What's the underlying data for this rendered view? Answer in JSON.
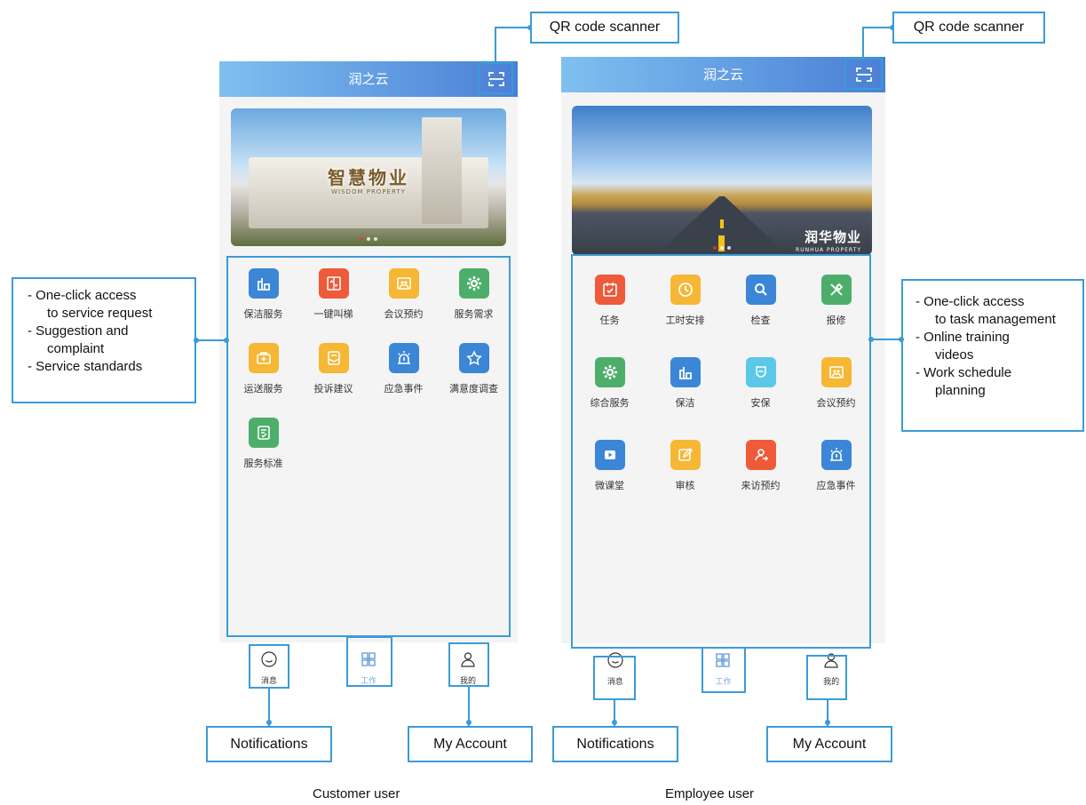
{
  "customer": {
    "app_title": "润之云",
    "banner": {
      "title": "智慧物业",
      "subtitle": "WISDOM PROPERTY"
    },
    "tiles": [
      {
        "label": "保洁服务",
        "icon": "building-icon",
        "color": "#3b86d6"
      },
      {
        "label": "一键叫梯",
        "icon": "elevator-icon",
        "color": "#ee5a3a"
      },
      {
        "label": "会议预约",
        "icon": "meeting-icon",
        "color": "#f6b735"
      },
      {
        "label": "服务需求",
        "icon": "gear-icon",
        "color": "#4dae6b"
      },
      {
        "label": "运送服务",
        "icon": "medkit-icon",
        "color": "#f6b735"
      },
      {
        "label": "投诉建议",
        "icon": "mail-icon",
        "color": "#f6b735"
      },
      {
        "label": "应急事件",
        "icon": "alarm-icon",
        "color": "#3b86d6"
      },
      {
        "label": "满意度调查",
        "icon": "star-icon",
        "color": "#3b86d6"
      },
      {
        "label": "服务标准",
        "icon": "checklist-icon",
        "color": "#4dae6b"
      }
    ],
    "tabbar": [
      {
        "label": "消息",
        "icon": "chat-icon",
        "active": false
      },
      {
        "label": "工作",
        "icon": "work-grid-icon",
        "active": true
      },
      {
        "label": "我的",
        "icon": "user-icon",
        "active": false
      }
    ],
    "caption": "Customer user"
  },
  "employee": {
    "app_title": "润之云",
    "banner": {
      "brand": "润华物业",
      "brand_sub": "RUNHUA PROPERTY"
    },
    "tiles": [
      {
        "label": "任务",
        "icon": "calendar-check-icon",
        "color": "#ee5a3a"
      },
      {
        "label": "工时安排",
        "icon": "clock-icon",
        "color": "#f6b735"
      },
      {
        "label": "检查",
        "icon": "search-icon",
        "color": "#3b86d6"
      },
      {
        "label": "报修",
        "icon": "tools-icon",
        "color": "#4dae6b"
      },
      {
        "label": "综合服务",
        "icon": "gear-icon",
        "color": "#4dae6b"
      },
      {
        "label": "保洁",
        "icon": "building-icon",
        "color": "#3b86d6"
      },
      {
        "label": "安保",
        "icon": "shield-guard-icon",
        "color": "#5bc8e8"
      },
      {
        "label": "会议预约",
        "icon": "meeting-icon",
        "color": "#f6b735"
      },
      {
        "label": "微课堂",
        "icon": "video-icon",
        "color": "#3b86d6"
      },
      {
        "label": "审核",
        "icon": "edit-icon",
        "color": "#f6b735"
      },
      {
        "label": "来访预约",
        "icon": "visitor-icon",
        "color": "#ee5a3a"
      },
      {
        "label": "应急事件",
        "icon": "alarm-icon",
        "color": "#3b86d6"
      }
    ],
    "tabbar": [
      {
        "label": "消息",
        "icon": "chat-icon",
        "active": false
      },
      {
        "label": "工作",
        "icon": "work-grid-icon",
        "active": true
      },
      {
        "label": "我的",
        "icon": "user-icon",
        "active": false
      }
    ],
    "caption": "Employee user"
  },
  "annotations": {
    "qr_scanner": "QR code scanner",
    "notifications": "Notifications",
    "my_account": "My Account",
    "customer_features": [
      {
        "text": "- One-click access",
        "indent": false
      },
      {
        "text": "to service request",
        "indent": true
      },
      {
        "text": "- Suggestion and",
        "indent": false
      },
      {
        "text": "complaint",
        "indent": true
      },
      {
        "text": "- Service standards",
        "indent": false
      }
    ],
    "employee_features": [
      {
        "text": "- One-click access",
        "indent": false
      },
      {
        "text": "to task management",
        "indent": true
      },
      {
        "text": "- Online training",
        "indent": false
      },
      {
        "text": "videos",
        "indent": true
      },
      {
        "text": "- Work schedule",
        "indent": false
      },
      {
        "text": "planning",
        "indent": true
      }
    ]
  },
  "colors": {
    "accent": "#3b9bd6",
    "header_start": "#7fc0f0",
    "header_end": "#4a7fd6"
  }
}
